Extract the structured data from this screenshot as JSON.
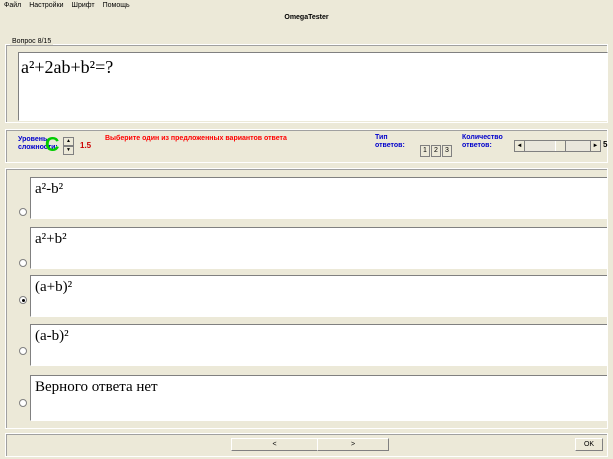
{
  "menu": {
    "items": [
      "Файл",
      "Настройки",
      "Шрифт",
      "Помощь"
    ]
  },
  "window": {
    "title": "OmegaTester"
  },
  "question": {
    "label": "Вопрос 8/15",
    "text": "a²+2ab+b²=?"
  },
  "controls": {
    "level_label_1": "Уровень",
    "level_label_2": "сложности:",
    "level_grade": "C",
    "level_value": "1.5",
    "instruction": "Выберите один из предложенных вариантов ответа",
    "type_label_1": "Тип",
    "type_label_2": "ответов:",
    "type_buttons": [
      "1",
      "2",
      "3"
    ],
    "count_label_1": "Количество",
    "count_label_2": "ответов:",
    "count_value": "5"
  },
  "answers": [
    {
      "text": "a²-b²",
      "selected": false
    },
    {
      "text": "a²+b²",
      "selected": false
    },
    {
      "text": "(a+b)²",
      "selected": true
    },
    {
      "text": "(a-b)²",
      "selected": false
    },
    {
      "text": "Верного ответа нет",
      "selected": false
    }
  ],
  "nav": {
    "prev": "<",
    "next": ">",
    "ok": "OK"
  },
  "colors": {
    "background": "#ece9d8",
    "level_grade": "#00cc00",
    "instruction": "#ff0000",
    "labels": "#0000cc"
  }
}
